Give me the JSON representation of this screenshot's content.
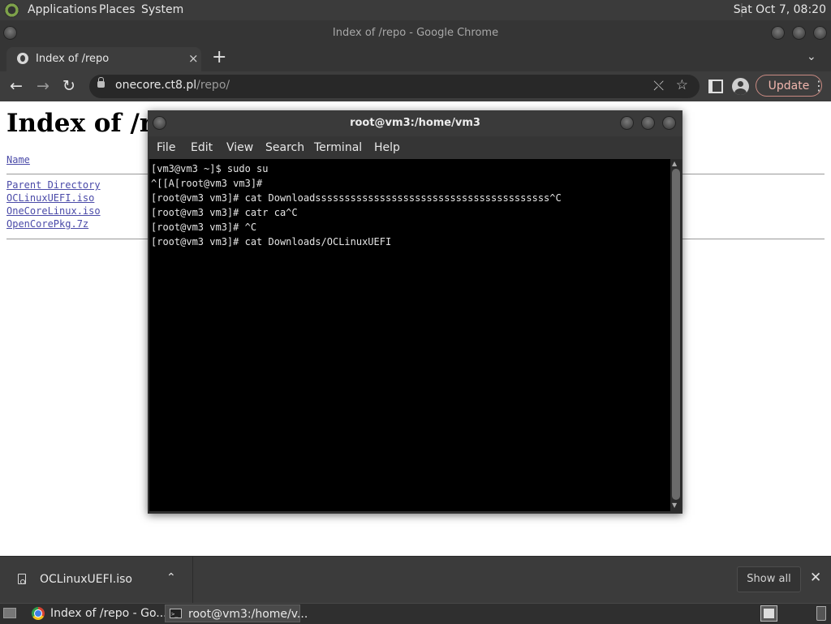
{
  "panel": {
    "menus": [
      "Applications",
      "Places",
      "System"
    ],
    "clock": "Sat Oct  7, 08:20"
  },
  "chrome": {
    "window_title": "Index of /repo - Google Chrome",
    "tab_title": "Index of /repo",
    "tab_close": "×",
    "new_tab": "+",
    "url_host": "onecore.ct8.pl",
    "url_path": "/repo/",
    "update_label": "Update"
  },
  "page": {
    "title": "Index of /repo",
    "column_name": "Name",
    "links": [
      "Parent Directory",
      "OCLinuxUEFI.iso",
      "OneCoreLinux.iso",
      "OpenCorePkg.7z"
    ]
  },
  "terminal": {
    "title": "root@vm3:/home/vm3",
    "menu": [
      "File",
      "Edit",
      "View",
      "Search",
      "Terminal",
      "Help"
    ],
    "lines": [
      "[vm3@vm3 ~]$ sudo su",
      "^[[A[root@vm3 vm3]#",
      "[root@vm3 vm3]# cat Downloadssssssssssssssssssssssssssssssssssssssss^C",
      "[root@vm3 vm3]# catr ca^C",
      "[root@vm3 vm3]# ^C",
      "[root@vm3 vm3]# cat Downloads/OCLinuxUEFI"
    ]
  },
  "downloads": {
    "filename": "OCLinuxUEFI.iso",
    "show_all_label": "Show all"
  },
  "taskbar": {
    "chrome_task": "Index of /repo - Go...",
    "terminal_task": "root@vm3:/home/v..."
  },
  "colors": {
    "panel_bg": "#3b3b3b",
    "chrome_frame": "#353535",
    "toolbar_bg": "#3d3d3d",
    "link": "#4a4aa8",
    "terminal_bg": "#000000",
    "update_accent": "#f1b6ae"
  },
  "icons": [
    "distro-logo-icon",
    "globe-icon",
    "close-icon",
    "plus-icon",
    "chevron-down-icon",
    "back-arrow-icon",
    "forward-arrow-icon",
    "reload-icon",
    "lock-icon",
    "share-icon",
    "star-icon",
    "side-panel-icon",
    "profile-icon",
    "kebab-menu-icon",
    "file-icon",
    "chevron-up-icon",
    "show-desktop-icon",
    "chrome-icon",
    "terminal-icon",
    "workspace-icon",
    "trash-icon"
  ]
}
